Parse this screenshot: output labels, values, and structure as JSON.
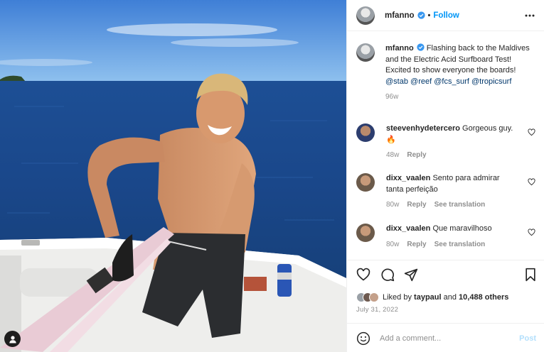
{
  "header": {
    "username": "mfanno",
    "separator": "•",
    "follow_label": "Follow"
  },
  "caption": {
    "username": "mfanno",
    "text": "Flashing back to the Maldives and the Electric Acid Surfboard Test! Excited to show everyone the boards!",
    "mentions": [
      "@stab",
      "@reef",
      "@fcs_surf",
      "@tropicsurf"
    ],
    "time": "96w"
  },
  "comments": [
    {
      "username": "steevenhydetercero",
      "text": "Gorgeous guy. 🔥",
      "time": "48w",
      "reply": "Reply",
      "translate": ""
    },
    {
      "username": "dixx_vaalen",
      "text": "Sento para admirar tanta perfeição",
      "time": "80w",
      "reply": "Reply",
      "translate": "See translation"
    },
    {
      "username": "dixx_vaalen",
      "text": "Que maravilhoso",
      "time": "80w",
      "reply": "Reply",
      "translate": "See translation"
    }
  ],
  "likes": {
    "prefix": "Liked by",
    "user": "taypaul",
    "and": "and",
    "count": "10,488 others"
  },
  "date": "July 31, 2022",
  "comment_box": {
    "placeholder": "Add a comment...",
    "post_label": "Post"
  },
  "icons": {
    "verified": "verified-badge-icon",
    "more": "more-options-icon",
    "like": "heart-icon",
    "comment": "comment-icon",
    "share": "share-icon",
    "save": "bookmark-icon",
    "emoji": "emoji-icon",
    "user_tag": "user-tag-icon"
  },
  "colors": {
    "link": "#00376b",
    "follow": "#0095f6",
    "post_disabled": "#b2dffc",
    "muted": "#8e8e8e",
    "verified": "#3897f0"
  }
}
